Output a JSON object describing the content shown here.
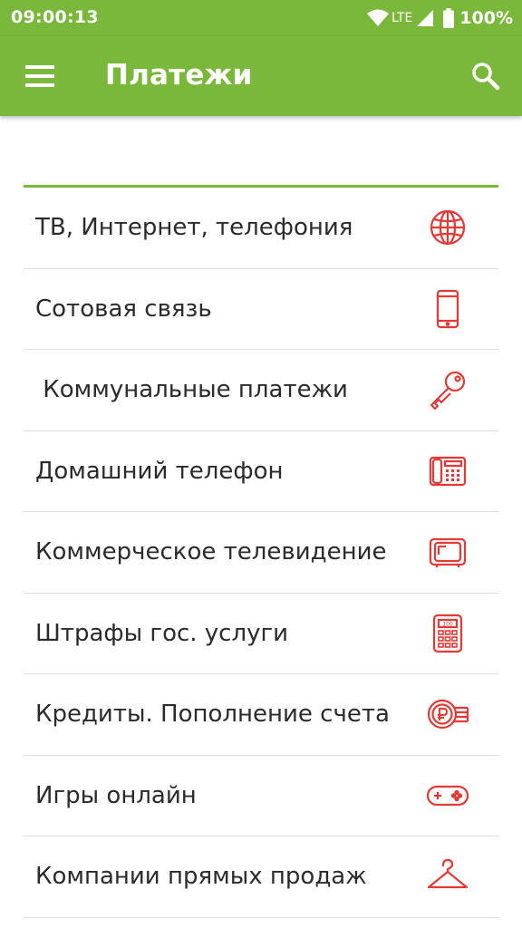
{
  "status_bar": {
    "time": "09:00:13",
    "network": "LTE",
    "battery": "100%"
  },
  "app_bar": {
    "title": "Платежи",
    "menu_icon": "hamburger-menu-icon",
    "search_icon": "search-icon",
    "background_color": "#79b83a"
  },
  "accent_color": "#79b83a",
  "icon_color": "#e53935",
  "categories": [
    {
      "label": "ТВ, Интернет, телефония",
      "icon": "globe-icon"
    },
    {
      "label": "Сотовая связь",
      "icon": "mobile-phone-icon"
    },
    {
      "label": " Коммунальные платежи",
      "icon": "key-icon"
    },
    {
      "label": "Домашний телефон",
      "icon": "landline-phone-icon"
    },
    {
      "label": "Коммерческое телевидение",
      "icon": "television-icon"
    },
    {
      "label": "Штрафы гос. услуги",
      "icon": "calculator-icon"
    },
    {
      "label": "Кредиты. Пополнение счета",
      "icon": "ruble-coin-icon"
    },
    {
      "label": "Игры онлайн",
      "icon": "gamepad-icon"
    },
    {
      "label": "Компании прямых продаж",
      "icon": "hanger-icon"
    }
  ]
}
